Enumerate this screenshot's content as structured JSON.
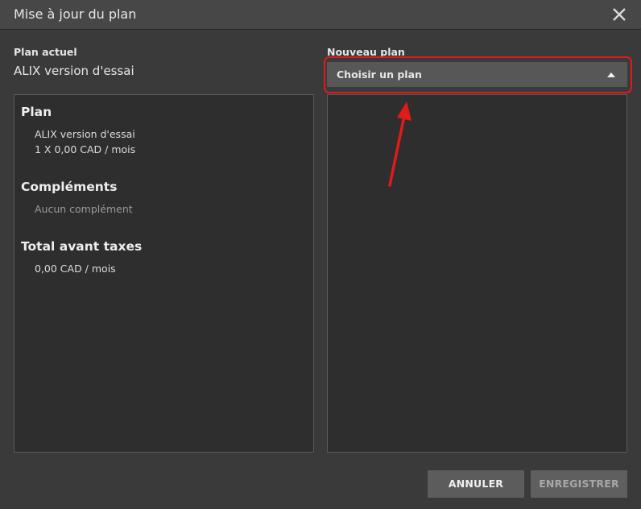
{
  "dialog": {
    "title": "Mise à jour du plan",
    "close_icon": "close-icon"
  },
  "current": {
    "label": "Plan actuel",
    "plan_name": "ALIX version d'essai",
    "summary": {
      "plan_heading": "Plan",
      "plan_name": "ALIX version d'essai",
      "plan_price": "1 X 0,00 CAD / mois",
      "addons_heading": "Compléments",
      "addons_empty": "Aucun complément",
      "total_heading": "Total avant taxes",
      "total_value": "0,00 CAD / mois"
    }
  },
  "new_plan": {
    "label": "Nouveau plan",
    "select_value": "Choisir un plan",
    "caret_icon": "caret-up-icon"
  },
  "annotation": {
    "highlight_color": "#e11a1a",
    "arrow_icon": "arrow-up-icon"
  },
  "buttons": {
    "cancel": "ANNULER",
    "save": "ENREGISTRER"
  }
}
